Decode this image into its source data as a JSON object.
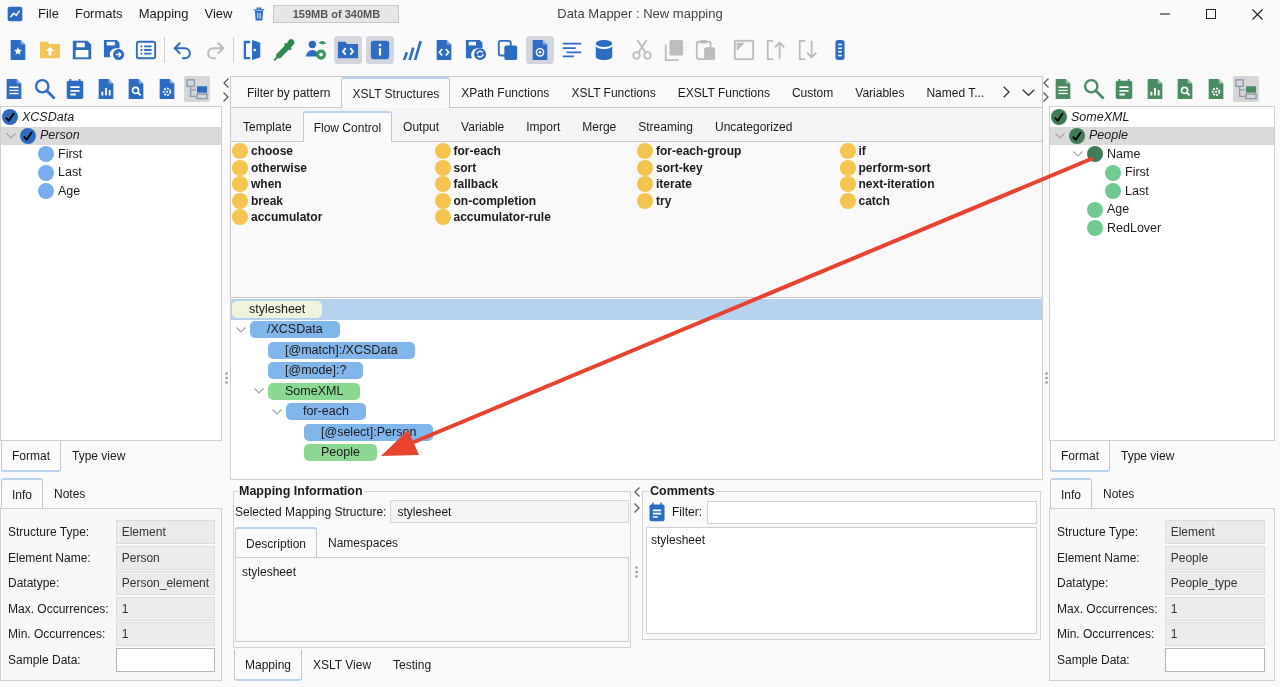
{
  "window": {
    "title": "Data Mapper : New mapping"
  },
  "menu": [
    {
      "label": "File"
    },
    {
      "label": "Formats"
    },
    {
      "label": "Mapping"
    },
    {
      "label": "View"
    }
  ],
  "memory": {
    "label": "159MB of 340MB"
  },
  "toolbar": [
    {
      "divider": true,
      "items": [
        {
          "pressed": false,
          "disabled": false
        },
        {
          "pressed": false,
          "disabled": false
        },
        {
          "pressed": false,
          "disabled": false
        },
        {
          "pressed": false,
          "disabled": false
        },
        {
          "pressed": false,
          "disabled": false
        }
      ]
    },
    {
      "divider": true,
      "items": [
        {
          "pressed": false,
          "disabled": false
        },
        {
          "pressed": false,
          "disabled": true
        }
      ]
    },
    {
      "divider": false,
      "items": [
        {
          "pressed": false,
          "disabled": false
        },
        {
          "pressed": false,
          "disabled": false
        },
        {
          "pressed": false,
          "disabled": false
        },
        {
          "pressed": true,
          "disabled": false
        },
        {
          "pressed": true,
          "disabled": false
        },
        {
          "pressed": false,
          "disabled": false
        },
        {
          "pressed": false,
          "disabled": false
        },
        {
          "pressed": false,
          "disabled": false
        },
        {
          "pressed": false,
          "disabled": false
        },
        {
          "pressed": true,
          "disabled": false
        },
        {
          "pressed": false,
          "disabled": false
        },
        {
          "pressed": false,
          "disabled": false
        }
      ]
    },
    {
      "divider": false,
      "items": [
        {
          "pressed": false,
          "disabled": true
        },
        {
          "pressed": false,
          "disabled": true
        },
        {
          "pressed": false,
          "disabled": true
        }
      ]
    },
    {
      "divider": false,
      "items": [
        {
          "pressed": false,
          "disabled": true
        },
        {
          "pressed": false,
          "disabled": true
        },
        {
          "pressed": false,
          "disabled": true
        },
        {
          "pressed": false,
          "disabled": false
        }
      ]
    }
  ],
  "source_panel": {
    "toolbar": [
      {
        "pressed": false
      },
      {
        "pressed": false
      },
      {
        "pressed": false
      },
      {
        "pressed": false
      },
      {
        "pressed": false
      },
      {
        "pressed": false
      },
      {
        "pressed": true
      }
    ],
    "tree": {
      "label": "XCSData",
      "kind": "record",
      "selected": false,
      "children": [
        {
          "label": "Person",
          "kind": "record",
          "selected": true,
          "expanded": true,
          "children": [
            {
              "label": "First",
              "kind": "field",
              "selected": false
            },
            {
              "label": "Last",
              "kind": "field",
              "selected": false
            },
            {
              "label": "Age",
              "kind": "field",
              "selected": false
            }
          ]
        }
      ]
    },
    "view_tabs": [
      {
        "label": "Format",
        "selected": true
      },
      {
        "label": "Type view",
        "selected": false
      }
    ],
    "info_tabs": [
      {
        "label": "Info",
        "selected": true
      },
      {
        "label": "Notes",
        "selected": false
      }
    ],
    "fields": [
      {
        "label": "Structure Type:",
        "value": "Element",
        "editable": false
      },
      {
        "label": "Element Name:",
        "value": "Person",
        "editable": false
      },
      {
        "label": "Datatype:",
        "value": "Person_element",
        "editable": false
      },
      {
        "label": "Max. Occurrences:",
        "value": "1",
        "editable": false
      },
      {
        "label": "Min. Occurrences:",
        "value": "1",
        "editable": false
      },
      {
        "label": "Sample Data:",
        "editable": true
      }
    ]
  },
  "palette": {
    "tabs": [
      {
        "label": "Filter by pattern",
        "selected": false
      },
      {
        "label": "XSLT Structures",
        "selected": true
      },
      {
        "label": "XPath Functions",
        "selected": false
      },
      {
        "label": "XSLT Functions",
        "selected": false
      },
      {
        "label": "EXSLT Functions",
        "selected": false
      },
      {
        "label": "Custom",
        "selected": false
      },
      {
        "label": "Variables",
        "selected": false
      },
      {
        "label": "Named T...",
        "selected": false
      }
    ],
    "subtabs": [
      {
        "label": "Template",
        "selected": false
      },
      {
        "label": "Flow Control",
        "selected": true
      },
      {
        "label": "Output",
        "selected": false
      },
      {
        "label": "Variable",
        "selected": false
      },
      {
        "label": "Import",
        "selected": false
      },
      {
        "label": "Merge",
        "selected": false
      },
      {
        "label": "Streaming",
        "selected": false
      },
      {
        "label": "Uncategorized",
        "selected": false
      }
    ],
    "columns": [
      [
        "choose",
        "otherwise",
        "when",
        "break",
        "accumulator"
      ],
      [
        "for-each",
        "sort",
        "fallback",
        "on-completion",
        "accumulator-rule"
      ],
      [
        "for-each-group",
        "sort-key",
        "iterate",
        "try"
      ],
      [
        "if",
        "perform-sort",
        "next-iteration",
        "catch"
      ]
    ]
  },
  "mapping_tree": {
    "label": "stylesheet",
    "kind": "root",
    "selected": true,
    "children": [
      {
        "label": "/XCSData",
        "kind": "instruction",
        "selected": false,
        "expanded": true,
        "children": [
          {
            "label": "[@match]:/XCSData",
            "kind": "instruction",
            "selected": false
          },
          {
            "label": "[@mode]:?",
            "kind": "instruction",
            "selected": false
          },
          {
            "label": "SomeXML",
            "kind": "output",
            "selected": false,
            "expanded": true,
            "children": [
              {
                "label": "for-each",
                "kind": "instruction",
                "selected": false,
                "expanded": true,
                "children": [
                  {
                    "label": "[@select]:Person",
                    "kind": "instruction",
                    "selected": false
                  },
                  {
                    "label": "People",
                    "kind": "output",
                    "selected": false
                  }
                ]
              }
            ]
          }
        ]
      }
    ]
  },
  "mapping_information": {
    "title": "Mapping Information",
    "selected_structure": {
      "label": "Selected Mapping Structure:",
      "value": "stylesheet"
    },
    "tabs": [
      {
        "label": "Description",
        "selected": true
      },
      {
        "label": "Namespaces",
        "selected": false
      }
    ],
    "description": "stylesheet"
  },
  "comments": {
    "title": "Comments",
    "filter": {
      "label": "Filter:"
    },
    "items": [
      "stylesheet"
    ]
  },
  "bottom_tabs": [
    {
      "label": "Mapping",
      "selected": true
    },
    {
      "label": "XSLT View",
      "selected": false
    },
    {
      "label": "Testing",
      "selected": false
    }
  ],
  "target_panel": {
    "toolbar": [
      {
        "pressed": false
      },
      {
        "pressed": false
      },
      {
        "pressed": false
      },
      {
        "pressed": false
      },
      {
        "pressed": false
      },
      {
        "pressed": false
      },
      {
        "pressed": true
      }
    ],
    "tree": {
      "label": "SomeXML",
      "kind": "record",
      "selected": false,
      "children": [
        {
          "label": "People",
          "kind": "record",
          "selected": true,
          "expanded": true,
          "children": [
            {
              "label": "Name",
              "kind": "group",
              "selected": false,
              "expanded": true,
              "children": [
                {
                  "label": "First",
                  "kind": "field",
                  "selected": false
                },
                {
                  "label": "Last",
                  "kind": "field",
                  "selected": false
                }
              ]
            },
            {
              "label": "Age",
              "kind": "field",
              "selected": false
            },
            {
              "label": "RedLover",
              "kind": "field",
              "selected": false
            }
          ]
        }
      ]
    },
    "view_tabs": [
      {
        "label": "Format",
        "selected": true
      },
      {
        "label": "Type view",
        "selected": false
      }
    ],
    "info_tabs": [
      {
        "label": "Info",
        "selected": true
      },
      {
        "label": "Notes",
        "selected": false
      }
    ],
    "fields": [
      {
        "label": "Structure Type:",
        "value": "Element",
        "editable": false
      },
      {
        "label": "Element Name:",
        "value": "People",
        "editable": false
      },
      {
        "label": "Datatype:",
        "value": "People_type",
        "editable": false
      },
      {
        "label": "Max. Occurrences:",
        "value": "1",
        "editable": false
      },
      {
        "label": "Min. Occurrences:",
        "value": "1",
        "editable": false
      },
      {
        "label": "Sample Data:",
        "editable": true
      }
    ]
  },
  "annotation": {
    "kind": "arrow"
  }
}
